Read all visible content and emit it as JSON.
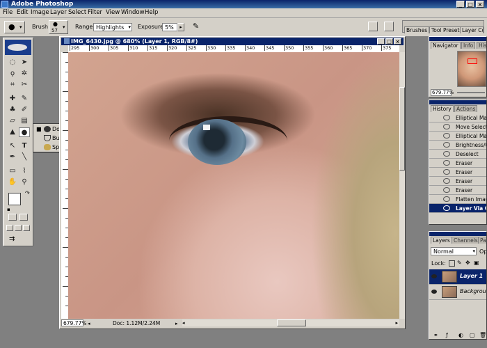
{
  "app": {
    "title": "Adobe Photoshop",
    "window_buttons": [
      "_",
      "□",
      "×"
    ]
  },
  "menu": [
    "File",
    "Edit",
    "Image",
    "Layer",
    "Select",
    "Filter",
    "View",
    "Window",
    "Help"
  ],
  "options": {
    "brush_label": "Brush:",
    "brush_size": "57",
    "range_label": "Range:",
    "range_value": "Highlights",
    "exposure_label": "Exposure:",
    "exposure_value": "5%",
    "exposure_arrow": "▸"
  },
  "palette_well": {
    "tabs": [
      "Brushes",
      "Tool Presets",
      "Layer Comps"
    ]
  },
  "flyout": {
    "items": [
      {
        "label": "Dodge Tool",
        "icon": "dodge-icon"
      },
      {
        "label": "Burn Tool",
        "icon": "burn-icon"
      },
      {
        "label": "Sponge Tool",
        "icon": "sponge-icon"
      }
    ]
  },
  "document": {
    "title": "IMG_6430.jpg @ 680% (Layer 1, RGB/8#)",
    "ruler_ticks": [
      "295",
      "300",
      "305",
      "310",
      "315",
      "320",
      "325",
      "330",
      "335",
      "340",
      "345",
      "350",
      "355",
      "360",
      "365",
      "370",
      "375"
    ],
    "zoom": "679.77%",
    "doc_info": "Doc: 1.12M/2.24M"
  },
  "navigator": {
    "tabs": [
      "Navigator",
      "Info",
      "Histogram"
    ],
    "zoom": "679.77%"
  },
  "history": {
    "tabs": [
      "History",
      "Actions"
    ],
    "items": [
      "Elliptical Marquee",
      "Move Selection",
      "Elliptical Marquee",
      "Brightness/Contrast",
      "Deselect",
      "Eraser",
      "Eraser",
      "Eraser",
      "Eraser",
      "Flatten Image",
      "Layer Via Copy"
    ],
    "selected_index": 10
  },
  "layers": {
    "tabs": [
      "Layers",
      "Channels",
      "Paths"
    ],
    "blend_mode": "Normal",
    "opacity_label": "Op",
    "lock_label": "Lock:",
    "items": [
      {
        "name": "Layer 1",
        "selected": true
      },
      {
        "name": "Background",
        "selected": false
      }
    ]
  },
  "colors": {
    "accent": "#0a246a",
    "chrome": "#d4d0c8",
    "workspace": "#808080"
  }
}
